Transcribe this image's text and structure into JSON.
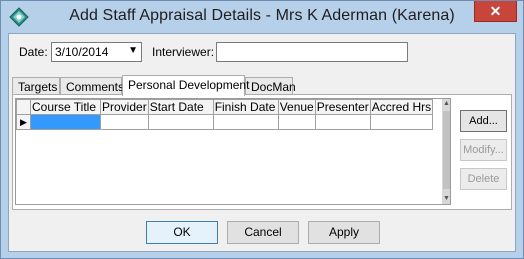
{
  "window": {
    "title": "Add Staff Appraisal Details - Mrs K Aderman (Karena)",
    "close_glyph": "✕"
  },
  "form": {
    "date_label": "Date:",
    "date_value": "3/10/2014",
    "interviewer_label": "Interviewer:",
    "interviewer_value": ""
  },
  "tabs": [
    {
      "label": "Targets",
      "active": false
    },
    {
      "label": "Comments",
      "active": false
    },
    {
      "label": "Personal Development",
      "active": true
    },
    {
      "label": "DocMan",
      "active": false
    }
  ],
  "grid": {
    "columns": [
      "Course Title",
      "Provider",
      "Start Date",
      "Finish Date",
      "Venue",
      "Presenter",
      "Accred Hrs"
    ],
    "row_indicator": "▶"
  },
  "side_buttons": {
    "add": "Add...",
    "modify": "Modify...",
    "delete": "Delete"
  },
  "buttons": {
    "ok": "OK",
    "cancel": "Cancel",
    "apply": "Apply"
  },
  "colors": {
    "window_frame": "#b7d0ea",
    "close_button": "#c7453a",
    "selected_cell": "#3399ff"
  }
}
